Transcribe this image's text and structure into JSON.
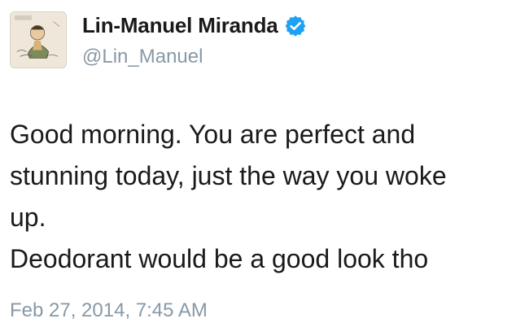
{
  "author": {
    "display_name": "Lin-Manuel Miranda",
    "handle": "@Lin_Manuel",
    "verified_icon": "verified-badge-icon",
    "avatar_icon": "sketch-portrait-avatar"
  },
  "tweet": {
    "lines": [
      "Good morning. You are perfect and",
      "stunning today, just the way you woke",
      "up.",
      "Deodorant would be a good look tho"
    ],
    "timestamp": "Feb 27, 2014, 7:45 AM"
  },
  "colors": {
    "verified_blue": "#1da1f2",
    "secondary_text": "#8899a6",
    "primary_text": "#1a1a1a"
  }
}
